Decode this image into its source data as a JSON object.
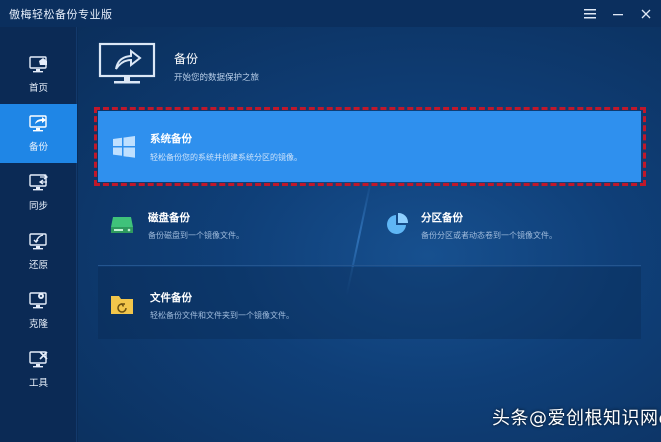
{
  "window": {
    "title": "傲梅轻松备份专业版",
    "menu_icon": "menu-lines-icon",
    "minimize_icon": "minimize-icon",
    "close_icon": "close-icon"
  },
  "sidebar": {
    "items": [
      {
        "label": "首页",
        "icon": "home-monitor-icon",
        "active": false
      },
      {
        "label": "备份",
        "icon": "backup-monitor-icon",
        "active": true
      },
      {
        "label": "同步",
        "icon": "sync-monitor-icon",
        "active": false
      },
      {
        "label": "还原",
        "icon": "restore-monitor-icon",
        "active": false
      },
      {
        "label": "克隆",
        "icon": "clone-monitor-icon",
        "active": false
      },
      {
        "label": "工具",
        "icon": "tools-monitor-icon",
        "active": false
      }
    ]
  },
  "header": {
    "title": "备份",
    "subtitle": "开始您的数据保护之旅"
  },
  "cards": {
    "system": {
      "title": "系统备份",
      "desc": "轻松备份您的系统并创建系统分区的镜像。",
      "icon": "windows-logo-icon"
    },
    "disk": {
      "title": "磁盘备份",
      "desc": "备份磁盘到一个镜像文件。",
      "icon": "disk-drive-icon"
    },
    "partition": {
      "title": "分区备份",
      "desc": "备份分区或者动态卷到一个镜像文件。",
      "icon": "pie-chart-icon"
    },
    "file": {
      "title": "文件备份",
      "desc": "轻松备份文件和文件夹到一个镜像文件。",
      "icon": "folder-icon"
    }
  },
  "watermark": {
    "text": "头条@爱创根知识网e"
  },
  "colors": {
    "accent": "#1f86e6",
    "selected_card": "#2f90ee",
    "highlight_border": "#c0182b",
    "background": "#0b2f5c"
  }
}
